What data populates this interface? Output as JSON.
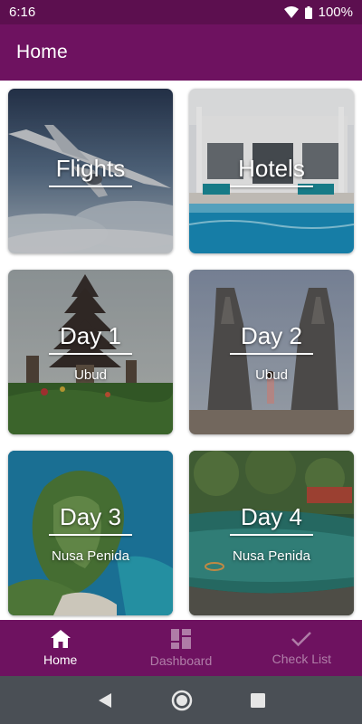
{
  "status_bar": {
    "time": "6:16",
    "battery": "100%"
  },
  "app_bar": {
    "title": "Home"
  },
  "cards": [
    {
      "title": "Flights",
      "subtitle": ""
    },
    {
      "title": "Hotels",
      "subtitle": ""
    },
    {
      "title": "Day 1",
      "subtitle": "Ubud"
    },
    {
      "title": "Day 2",
      "subtitle": "Ubud"
    },
    {
      "title": "Day 3",
      "subtitle": "Nusa Penida"
    },
    {
      "title": "Day 4",
      "subtitle": "Nusa Penida"
    }
  ],
  "bottom_nav": {
    "items": [
      {
        "label": "Home",
        "icon": "home-icon",
        "active": true
      },
      {
        "label": "Dashboard",
        "icon": "dashboard-icon",
        "active": false
      },
      {
        "label": "Check List",
        "icon": "check-icon",
        "active": false
      }
    ]
  },
  "colors": {
    "primary": "#6e1260",
    "primary_dark": "#5c0f4f",
    "system_nav": "#4a4f55"
  }
}
